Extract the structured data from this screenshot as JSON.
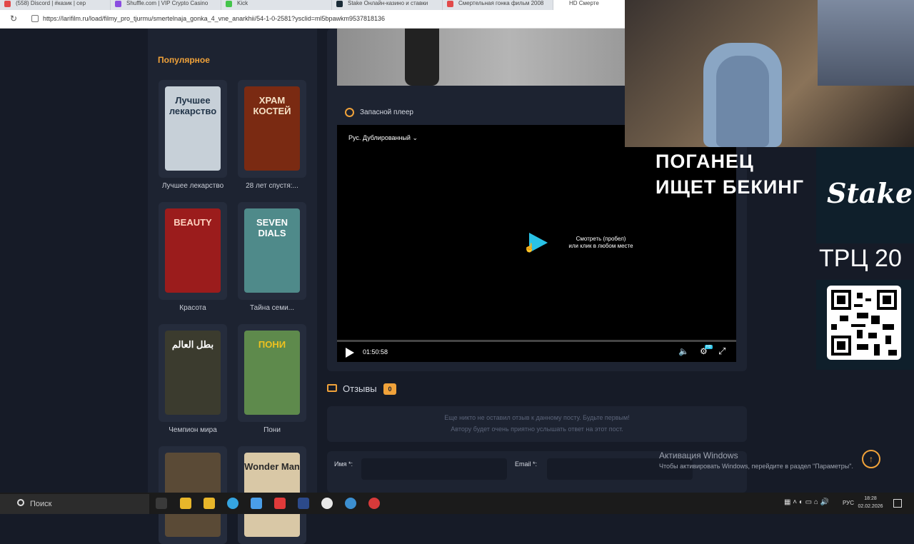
{
  "browser": {
    "tabs": [
      {
        "label": "(558) Discord | #казик | сер",
        "color": "#e24a4a"
      },
      {
        "label": "Shuffle.com | VIP Crypto Casino",
        "color": "#8a4de0"
      },
      {
        "label": "Kick",
        "color": "#43c44a"
      },
      {
        "label": "Stake Онлайн-казино и ставки",
        "color": "#1a2c38"
      },
      {
        "label": "Смертельная гонка фильм 2008",
        "color": "#e24a4a"
      },
      {
        "label": "HD Смерте",
        "color": "#ffffff"
      }
    ],
    "url": "https://larifilm.ru/load/filmy_pro_tjurmu/smertelnaja_gonka_4_vne_anarkhii/54-1-0-2581?ysclid=ml5bpawkm9537818136"
  },
  "sidebar": {
    "heading": "Популярное",
    "items": [
      {
        "title": "Лучшее лекарство",
        "poster_text": "Лучшее лекарство",
        "bg": "#c7d0d8",
        "fg": "#23364a"
      },
      {
        "title": "28 лет спустя:...",
        "poster_text": "ХРАМ КОСТЕЙ",
        "bg": "#7a2a12",
        "fg": "#f6e2c6"
      },
      {
        "title": "Красота",
        "poster_text": "BEAUTY",
        "bg": "#9b1c1c",
        "fg": "#ffd2c0"
      },
      {
        "title": "Тайна семи...",
        "poster_text": "SEVEN DIALS",
        "bg": "#4f8a8a",
        "fg": "#ffffff"
      },
      {
        "title": "Чемпион мира",
        "poster_text": "بطل العالم",
        "bg": "#3b3b2e",
        "fg": "#ffffff"
      },
      {
        "title": "Пони",
        "poster_text": "ПОНИ",
        "bg": "#5e8a4c",
        "fg": "#f0c21f"
      },
      {
        "title": "",
        "poster_text": "",
        "bg": "#5a4a36",
        "fg": "#ffffff"
      },
      {
        "title": "",
        "poster_text": "Wonder Man",
        "bg": "#d9c8a6",
        "fg": "#2a2a2a"
      }
    ]
  },
  "player": {
    "section_title": "Запасной плеер",
    "audio_track": "Рус. Дублированный",
    "hint_line1": "Смотреть (пробел)",
    "hint_line2": "или клик в любом месте",
    "duration": "01:50:58",
    "quality_badge": "HD"
  },
  "reviews": {
    "title": "Отзывы",
    "count": "0",
    "empty_line1": "Еще никто не оставил отзыв к данному посту. Будьте первым!",
    "empty_line2": "Автору будет очень приятно услышать ответ на этот пост.",
    "name_label": "Имя *:",
    "email_label": "Email *:"
  },
  "overlay": {
    "line1": "ПОГАНЕЦ",
    "line2": "ИЩЕТ БЕКИНГ",
    "stake_logo": "Stake",
    "trc": "ТРЦ 20"
  },
  "windows_activation": {
    "title": "Активация Windows",
    "text": "Чтобы активировать Windows, перейдите в раздел \"Параметры\"."
  },
  "taskbar": {
    "search_label": "Поиск",
    "language": "РУС",
    "time": "18:28",
    "date": "02.02.2026",
    "app_colors": [
      "#3a3a3a",
      "#e8b62a",
      "#e8b62a",
      "#35a4e0",
      "#4a9ee8",
      "#e03a3a",
      "#2c4a8a",
      "#e8e8e8",
      "#3c8fd0",
      "#d83a3a"
    ]
  }
}
